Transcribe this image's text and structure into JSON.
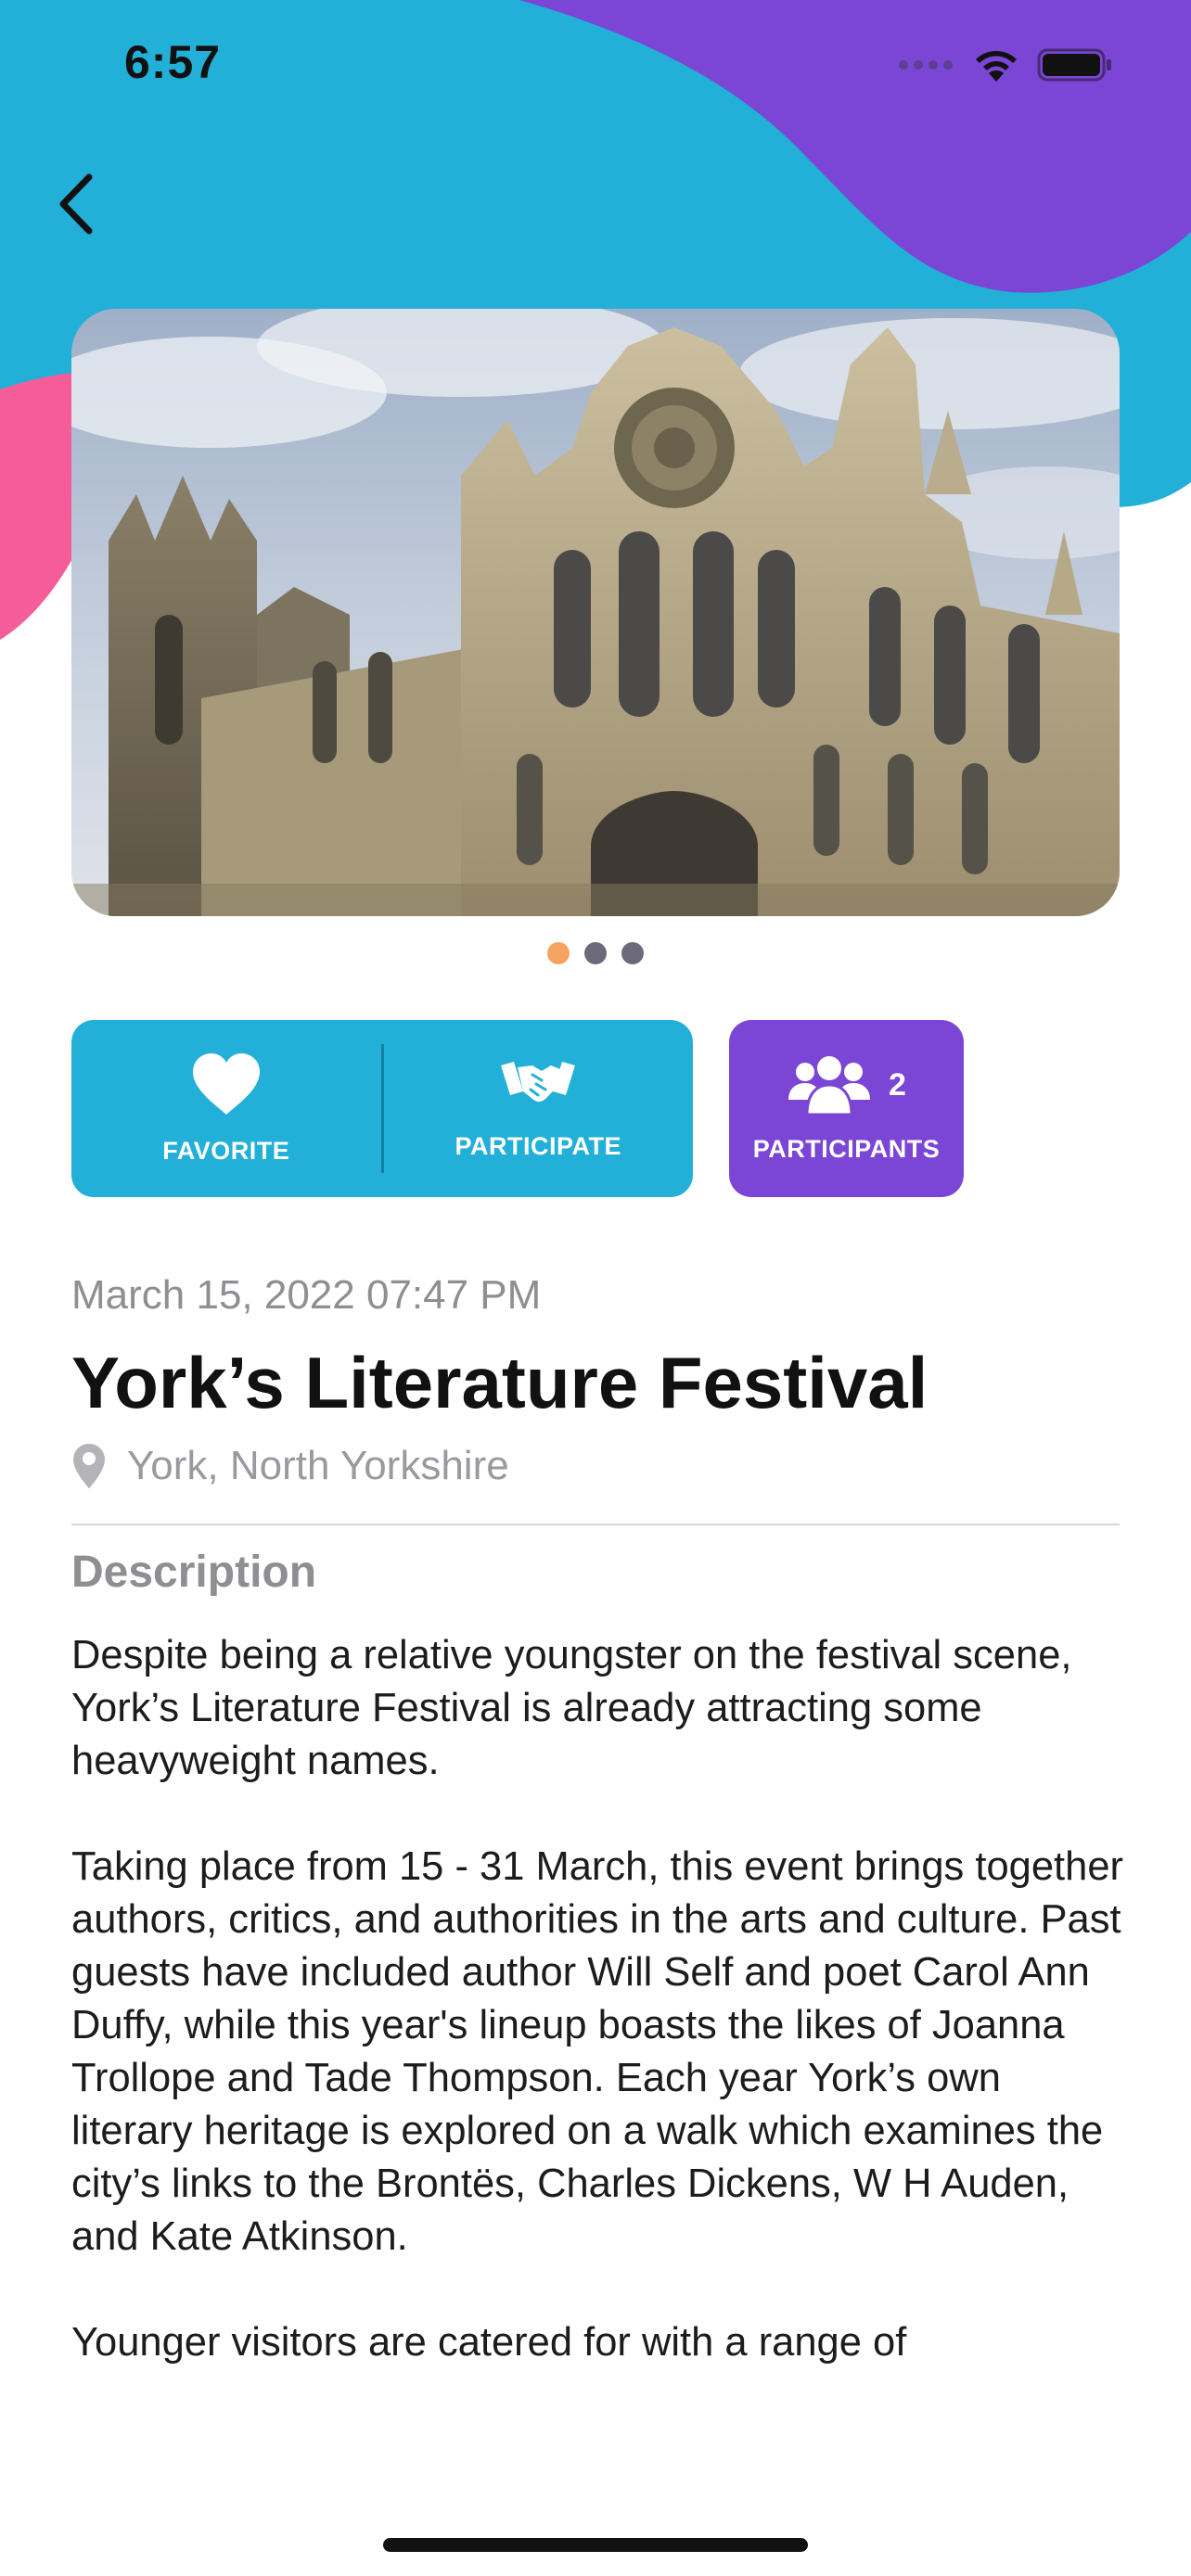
{
  "status_bar": {
    "time": "6:57",
    "signal_icon": "signal-dots-icon",
    "wifi_icon": "wifi-icon",
    "battery_icon": "battery-icon"
  },
  "nav": {
    "back_icon": "chevron-left-icon"
  },
  "colors": {
    "cyan": "#22b0d8",
    "purple": "#7b45d6",
    "pink": "#f45d9a",
    "dot_active": "#f4a460",
    "dot_inactive": "#6c6a7a"
  },
  "gallery": {
    "image_subject": "York Minster cathedral",
    "page_count": 3,
    "active_index": 0
  },
  "actions": {
    "favorite": {
      "label": "FAVORITE",
      "icon": "heart-icon"
    },
    "participate": {
      "label": "PARTICIPATE",
      "icon": "handshake-icon"
    },
    "participants": {
      "label": "PARTICIPANTS",
      "count": "2",
      "icon": "group-icon"
    }
  },
  "event": {
    "date": "March 15, 2022 07:47 PM",
    "title": "York’s Literature Festival",
    "location": "York, North Yorkshire",
    "location_icon": "map-pin-icon"
  },
  "description": {
    "heading": "Description",
    "paragraphs": [
      "Despite being a relative youngster on the festival scene, York’s Literature Festival is already attracting some heavyweight names.",
      "Taking place from 15 - 31 March, this event brings together authors, critics, and authorities in the arts and culture. Past guests have included author Will Self and poet Carol Ann Duffy, while this year's lineup boasts the likes of Joanna Trollope and Tade Thompson. Each year York’s own literary heritage is explored on a walk which examines the city’s links to the Brontës, Charles Dickens, W H Auden, and Kate Atkinson.",
      "Younger visitors are catered for with a range of"
    ]
  }
}
